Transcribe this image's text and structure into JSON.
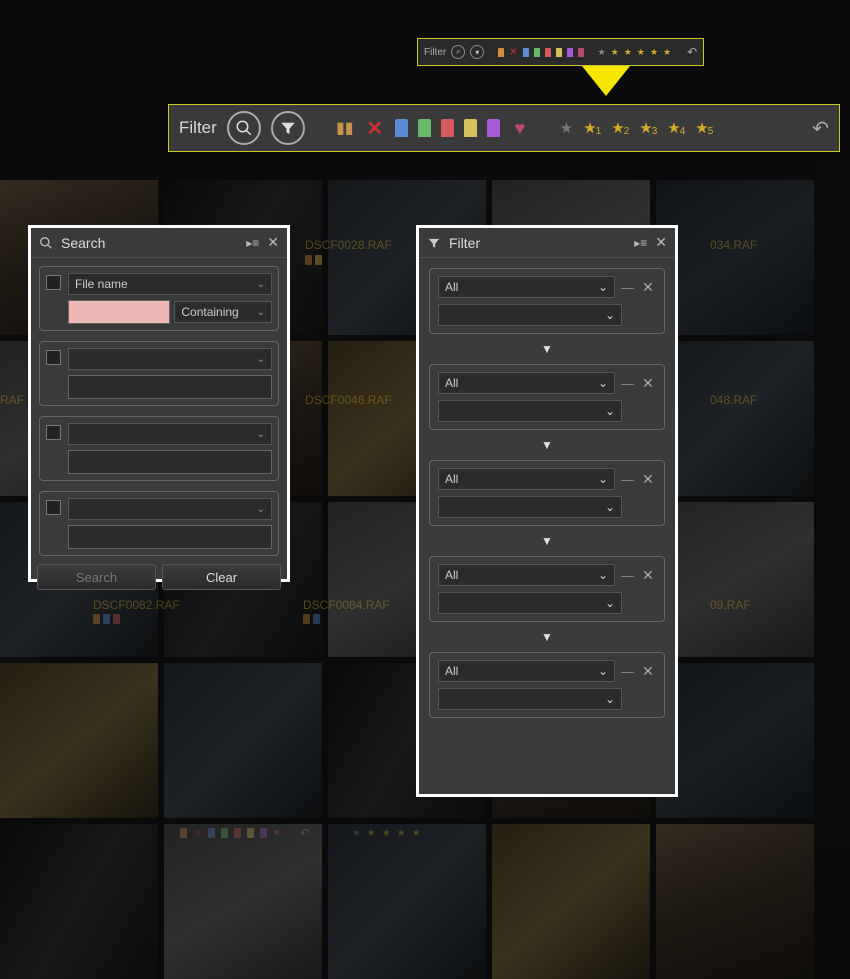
{
  "toolbar": {
    "label": "Filter",
    "tags": [
      "#5a8bd6",
      "#6ab86a",
      "#d65a5a",
      "#d6c25a",
      "#a65ad6",
      "#5ad6c2"
    ],
    "ratings": [
      1,
      2,
      3,
      4,
      5
    ]
  },
  "search_panel": {
    "title": "Search",
    "criteria": [
      {
        "field": "File name",
        "op": "Containing",
        "has_value": true
      },
      {
        "field": "",
        "op": "",
        "has_value": false
      },
      {
        "field": "",
        "op": "",
        "has_value": false
      },
      {
        "field": "",
        "op": "",
        "has_value": false
      }
    ],
    "buttons": {
      "search": "Search",
      "clear": "Clear"
    }
  },
  "filter_panel": {
    "title": "Filter",
    "groups": [
      {
        "value": "All"
      },
      {
        "value": "All"
      },
      {
        "value": "All"
      },
      {
        "value": "All"
      },
      {
        "value": "All"
      }
    ]
  },
  "filenames": {
    "a": "DSCF0028.RAF",
    "b": "DSCF0046.RAF",
    "c": "DSCF0082.RAF",
    "d": "DSCF0084.RAF",
    "e": "034.RAF",
    "f": "048.RAF",
    "g": "09.RAF"
  }
}
